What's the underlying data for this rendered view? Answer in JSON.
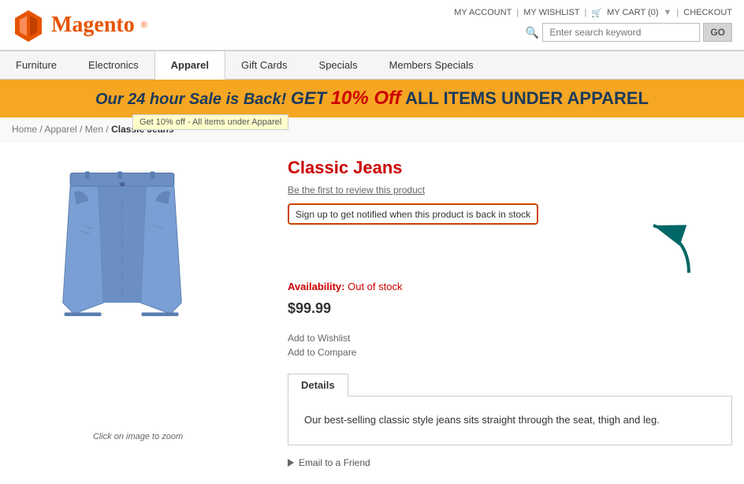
{
  "header": {
    "logo_text": "Magento",
    "logo_reg": "®",
    "links": {
      "my_account": "MY ACCOUNT",
      "my_wishlist": "MY WISHLIST",
      "my_cart": "MY CART (0)",
      "checkout": "CHECKOUT"
    },
    "search_placeholder": "Enter search keyword",
    "search_button": "GO"
  },
  "nav": {
    "items": [
      {
        "label": "Furniture",
        "active": false
      },
      {
        "label": "Electronics",
        "active": false
      },
      {
        "label": "Apparel",
        "active": true
      },
      {
        "label": "Gift Cards",
        "active": false
      },
      {
        "label": "Specials",
        "active": false
      },
      {
        "label": "Members Specials",
        "active": false
      }
    ]
  },
  "banner": {
    "text_italic": "Our 24 hour Sale is Back!",
    "text_get": "GET",
    "text_discount": "10% Off",
    "text_rest": "ALL ITEMS UNDER APPAREL",
    "tooltip": "Get 10% off - All items under Apparel"
  },
  "breadcrumb": {
    "home": "Home",
    "apparel": "Apparel",
    "men": "Men",
    "current": "Classic Jeans"
  },
  "product": {
    "title": "Classic Jeans",
    "review_link": "Be the first to review this product",
    "notify_link": "Sign up to get notified when this product is back in stock",
    "availability_label": "Availability:",
    "availability_status": "Out of stock",
    "price": "$99.99",
    "zoom_text": "Click on image to zoom",
    "add_to_wishlist": "Add to Wishlist",
    "add_to_compare": "Add to Compare",
    "tab_details": "Details",
    "description": "Our best-selling classic style jeans sits straight through the seat, thigh and leg.",
    "email_friend": "Email to a Friend"
  }
}
